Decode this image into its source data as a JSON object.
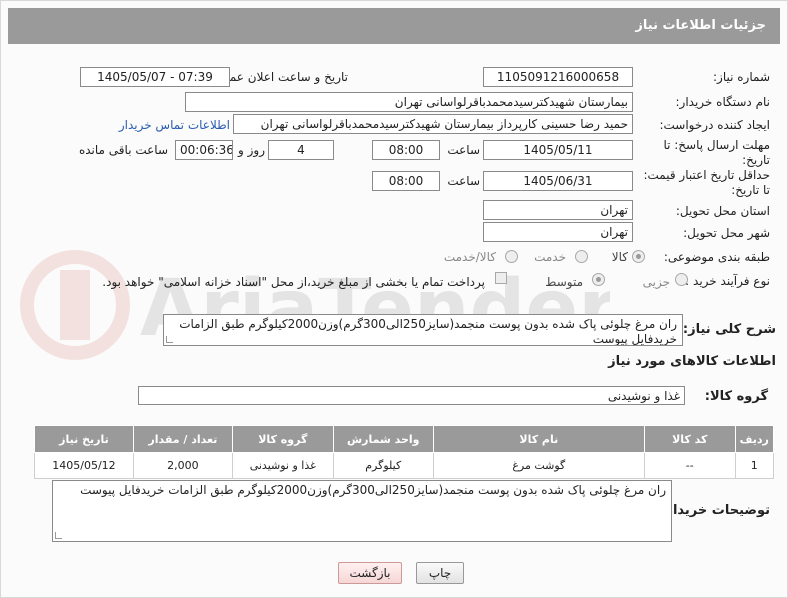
{
  "header": {
    "title": "جزئیات اطلاعات نیاز"
  },
  "fields": {
    "need_number_label": "شماره نیاز:",
    "need_number": "1105091216000658",
    "announce_label": "تاریخ و ساعت اعلان عمومی:",
    "announce_value": "1405/05/07 - 07:39",
    "buyer_org_label": "نام دستگاه خریدار:",
    "buyer_org": "بیمارستان شهیدکترسیدمحمدباقرلواسانی تهران",
    "creator_label": "ایجاد کننده درخواست:",
    "creator": "حمید رضا  حسینی کارپرداز بیمارستان شهیدکترسیدمحمدباقرلواسانی تهران",
    "contact_link": "اطلاعات تماس خریدار",
    "reply_label_1": "مهلت ارسال پاسخ: تا",
    "reply_label_2": "تاریخ:",
    "reply_date": "1405/05/11",
    "time_label": "ساعت",
    "reply_time": "08:00",
    "days_value": "4",
    "days_label": "روز و",
    "remaining_value": "00:06:36",
    "remaining_label": "ساعت باقی مانده",
    "price_label_1": "حداقل تاریخ اعتبار قیمت:",
    "price_label_2": "تا تاریخ:",
    "price_date": "1405/06/31",
    "price_time": "08:00",
    "province_label": "استان محل تحویل:",
    "province": "تهران",
    "city_label": "شهر محل تحویل:",
    "city": "تهران",
    "category_label": "طبقه بندی موضوعی:",
    "category_options": [
      "کالا",
      "خدمت",
      "کالا/خدمت"
    ],
    "category_selected": "کالا",
    "process_label": "نوع فرآیند خرید :",
    "process_options": [
      "جزیی",
      "متوسط"
    ],
    "process_selected": "متوسط",
    "payment_note": "پرداخت تمام یا بخشی از مبلغ خرید،از محل \"اسناد خزانه اسلامی\" خواهد بود."
  },
  "description": {
    "label": "شرح کلی نیاز:",
    "text": "ران مرغ چلوئی پاک شده بدون پوست منجمد(سایز250الی300گرم)وزن2000کیلوگرم طبق الزامات خریدفایل پیوست"
  },
  "goods": {
    "section_title": "اطلاعات کالاهای مورد نیاز",
    "group_label": "گروه کالا:",
    "group_value": "غذا و نوشیدنی",
    "columns": [
      "ردیف",
      "کد کالا",
      "نام کالا",
      "واحد شمارش",
      "گروه کالا",
      "تعداد / مقدار",
      "تاریخ نیاز"
    ],
    "rows": [
      [
        "1",
        "--",
        "گوشت مرغ",
        "کیلوگرم",
        "غذا و نوشیدنی",
        "2,000",
        "1405/05/12"
      ]
    ]
  },
  "buyer_notes": {
    "label": "توضیحات خریدار:",
    "text": "ران مرغ چلوئی پاک شده بدون پوست منجمد(سایز250الی300گرم)وزن2000کیلوگرم طبق الزامات خریدفایل پیوست"
  },
  "buttons": {
    "print": "چاپ",
    "back": "بازگشت"
  },
  "watermark": {
    "text": "AriaTender.neT"
  },
  "colors": {
    "header_bg": "#9a9a9a",
    "link": "#2a5db0",
    "back_button": "#f6d6d6"
  }
}
